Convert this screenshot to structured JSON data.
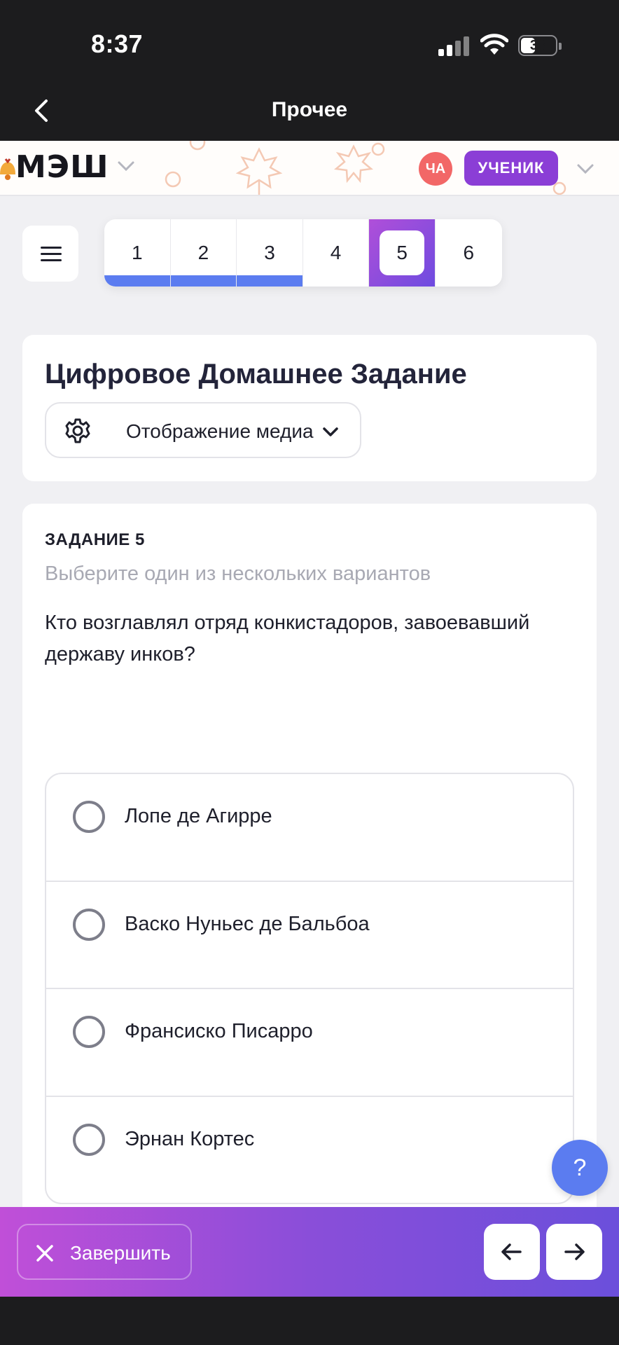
{
  "status_bar": {
    "time": "8:37",
    "battery": "38"
  },
  "nav": {
    "title": "Прочее",
    "back_icon": "chevron-left-icon"
  },
  "header": {
    "logo": "МЭШ",
    "avatar_initials": "ЧА",
    "role": "УЧЕНИК"
  },
  "tasks": {
    "items": [
      {
        "label": "1",
        "done": true
      },
      {
        "label": "2",
        "done": true
      },
      {
        "label": "3",
        "done": true
      },
      {
        "label": "4",
        "done": false
      },
      {
        "label": "5",
        "done": false,
        "active": true
      },
      {
        "label": "6",
        "done": false
      }
    ]
  },
  "title_card": {
    "title": "Цифровое Домашнее Задание",
    "media_select": "Отображение медиа"
  },
  "question": {
    "number": "ЗАДАНИЕ 5",
    "hint": "Выберите один из нескольких вариантов",
    "text": "Кто возглавлял отряд конкистадоров, завоевавший державу инков?",
    "options": [
      "Лопе де Агирре",
      "Васко Нуньес де Бальбоа",
      "Франсиско Писарро",
      "Эрнан Кортес"
    ]
  },
  "help": {
    "label": "?"
  },
  "bottom_bar": {
    "finish_label": "Завершить"
  },
  "colors": {
    "accent_blue": "#5b7cf0",
    "accent_purple": "#8b3ed6",
    "avatar": "#f26767"
  }
}
